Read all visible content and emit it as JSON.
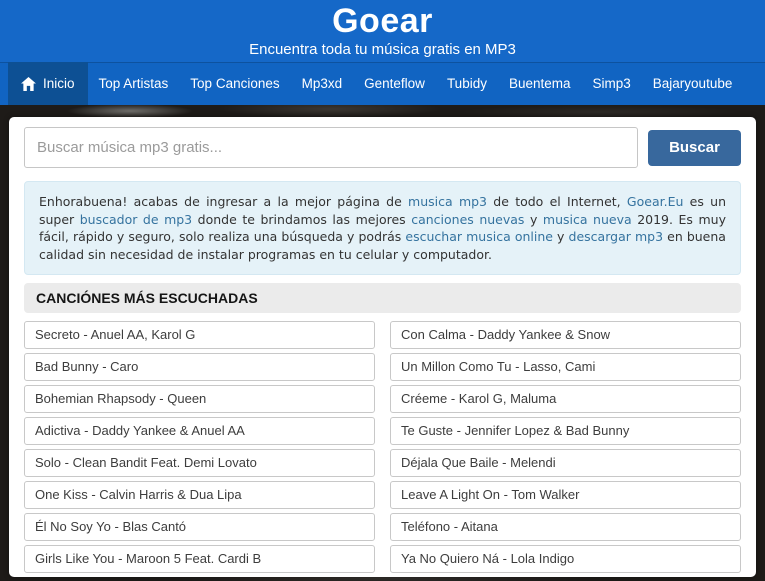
{
  "header": {
    "title": "Goear",
    "subtitle": "Encuentra toda tu música gratis en MP3"
  },
  "nav": {
    "items": [
      {
        "label": "Inicio",
        "active": true
      },
      {
        "label": "Top Artistas",
        "active": false
      },
      {
        "label": "Top Canciones",
        "active": false
      },
      {
        "label": "Mp3xd",
        "active": false
      },
      {
        "label": "Genteflow",
        "active": false
      },
      {
        "label": "Tubidy",
        "active": false
      },
      {
        "label": "Buentema",
        "active": false
      },
      {
        "label": "Simp3",
        "active": false
      },
      {
        "label": "Bajaryoutube",
        "active": false
      }
    ]
  },
  "search": {
    "placeholder": "Buscar música mp3 gratis...",
    "button_label": "Buscar"
  },
  "intro": {
    "segments": [
      {
        "text": "Enhorabuena! acabas de ingresar a la mejor página de ",
        "link": false
      },
      {
        "text": "musica mp3",
        "link": true
      },
      {
        "text": " de todo el Internet, ",
        "link": false
      },
      {
        "text": "Goear.Eu",
        "link": true
      },
      {
        "text": " es un super ",
        "link": false
      },
      {
        "text": "buscador de mp3",
        "link": true
      },
      {
        "text": " donde te brindamos las mejores ",
        "link": false
      },
      {
        "text": "canciones nuevas",
        "link": true
      },
      {
        "text": " y ",
        "link": false
      },
      {
        "text": "musica nueva",
        "link": true
      },
      {
        "text": " 2019. Es muy fácil, rápido y seguro, solo realiza una búsqueda y podrás ",
        "link": false
      },
      {
        "text": "escuchar musica online",
        "link": true
      },
      {
        "text": " y ",
        "link": false
      },
      {
        "text": "descargar mp3",
        "link": true
      },
      {
        "text": " en buena calidad sin necesidad de instalar programas en tu celular y computador.",
        "link": false
      }
    ]
  },
  "section": {
    "title": "CANCIÓNES MÁS ESCUCHADAS"
  },
  "songs": {
    "left_column": [
      "Secreto - Anuel AA, Karol G",
      "Bad Bunny - Caro",
      "Bohemian Rhapsody - Queen",
      "Adictiva - Daddy Yankee & Anuel AA",
      "Solo - Clean Bandit Feat. Demi Lovato",
      "One Kiss - Calvin Harris & Dua Lipa",
      "Él No Soy Yo - Blas Cantó",
      "Girls Like You - Maroon 5 Feat. Cardi B"
    ],
    "right_column": [
      "Con Calma - Daddy Yankee & Snow",
      "Un Millon Como Tu - Lasso, Cami",
      "Créeme - Karol G, Maluma",
      "Te Guste - Jennifer Lopez & Bad Bunny",
      "Déjala Que Baile - Melendi",
      "Leave A Light On - Tom Walker",
      "Teléfono - Aitana",
      "Ya No Quiero Ná - Lola Indigo"
    ]
  },
  "colors": {
    "header_bg": "#1568c8",
    "nav_bg": "#1164c2",
    "active_tab_bg": "#0d5094",
    "button_bg": "#38689d",
    "info_box_bg": "#e5f2f8",
    "link_color": "#35739f",
    "section_bar_bg": "#ebebeb",
    "page_bg": "#1e1b18"
  }
}
